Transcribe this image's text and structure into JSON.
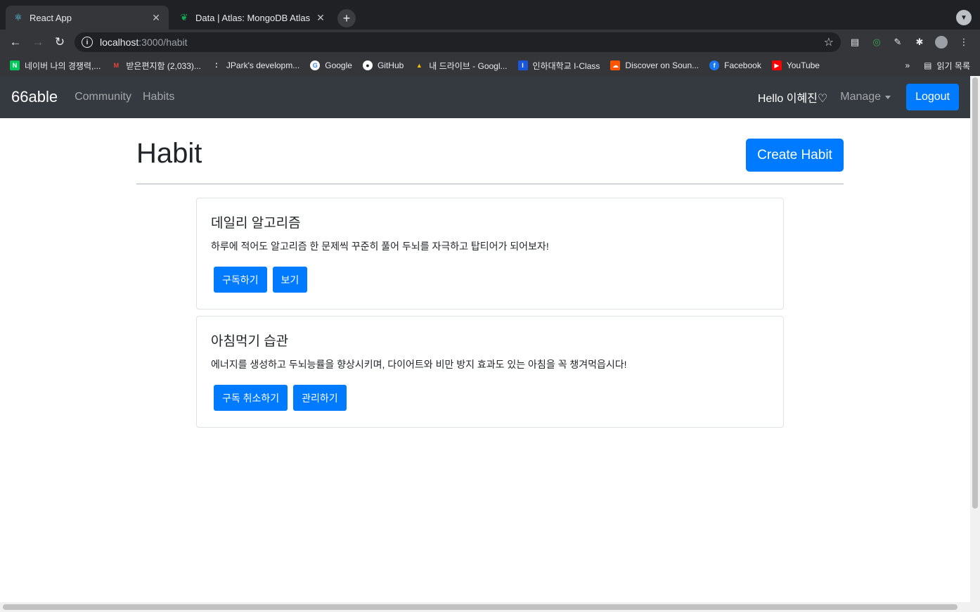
{
  "browser": {
    "tabs": [
      {
        "title": "React App",
        "icon": "react-icon",
        "active": true
      },
      {
        "title": "Data | Atlas: MongoDB Atlas",
        "icon": "mongodb-leaf-icon",
        "active": false
      }
    ],
    "address": {
      "host": "localhost",
      "path": ":3000/habit"
    },
    "bookmarks": [
      {
        "label": "네이버 나의 경쟁력,...",
        "icon": "naver-icon",
        "color": "#03c75a",
        "glyph": "N"
      },
      {
        "label": "받은편지함 (2,033)...",
        "icon": "gmail-icon",
        "color": "#ea4335",
        "glyph": "M"
      },
      {
        "label": "JPark's developm...",
        "icon": "dots-icon",
        "color": "#35363a",
        "glyph": "⁚"
      },
      {
        "label": "Google",
        "icon": "google-icon",
        "color": "#ffffff",
        "glyph": "G"
      },
      {
        "label": "GitHub",
        "icon": "github-icon",
        "color": "#ffffff",
        "glyph": "●"
      },
      {
        "label": "내 드라이브 - Googl...",
        "icon": "drive-icon",
        "color": "#fbbc04",
        "glyph": "▲"
      },
      {
        "label": "인하대학교 I-Class",
        "icon": "iclass-icon",
        "color": "#1a56db",
        "glyph": "I"
      },
      {
        "label": "Discover on Soun...",
        "icon": "soundcloud-icon",
        "color": "#ff5500",
        "glyph": "☁"
      },
      {
        "label": "Facebook",
        "icon": "facebook-icon",
        "color": "#1877f2",
        "glyph": "f"
      },
      {
        "label": "YouTube",
        "icon": "youtube-icon",
        "color": "#ff0000",
        "glyph": "▶"
      }
    ],
    "bookmarks_more": "»",
    "reading_list": "읽기 목록"
  },
  "navbar": {
    "brand": "66able",
    "links": [
      "Community",
      "Habits"
    ],
    "hello": "Hello 이혜진♡",
    "manage": "Manage",
    "logout": "Logout"
  },
  "page": {
    "title": "Habit",
    "create_button": "Create Habit"
  },
  "habits": [
    {
      "title": "데일리 알고리즘",
      "description": "하루에 적어도 알고리즘 한 문제씩 꾸준히 풀어 두뇌를 자극하고 탑티어가 되어보자!",
      "buttons": [
        "구독하기",
        "보기"
      ]
    },
    {
      "title": "아침먹기 습관",
      "description": "에너지를 생성하고 두뇌능률을 향상시키며, 다이어트와 비만 방지 효과도 있는 아침을 꼭 챙겨먹읍시다!",
      "buttons": [
        "구독 취소하기",
        "관리하기"
      ]
    }
  ],
  "colors": {
    "primary": "#007bff",
    "navbar": "#343a40"
  }
}
